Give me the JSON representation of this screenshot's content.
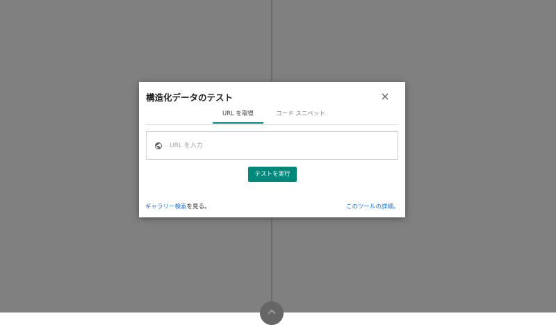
{
  "dialog": {
    "title": "構造化データのテスト",
    "tabs": [
      {
        "label": "URL を取得",
        "active": true
      },
      {
        "label": "コード スニペット",
        "active": false
      }
    ],
    "url_input": {
      "placeholder": "URL を入力",
      "value": ""
    },
    "run_button_label": "テストを実行",
    "footer": {
      "gallery_link": "ギャラリー検索",
      "gallery_suffix": "を見る。",
      "details_link": "このツールの詳細。"
    }
  },
  "icons": {
    "close": "close-icon",
    "globe": "globe-icon",
    "splitter": "chevron-up-icon"
  },
  "colors": {
    "accent": "#00897b",
    "link": "#1a73e8",
    "backdrop": "#808080"
  }
}
